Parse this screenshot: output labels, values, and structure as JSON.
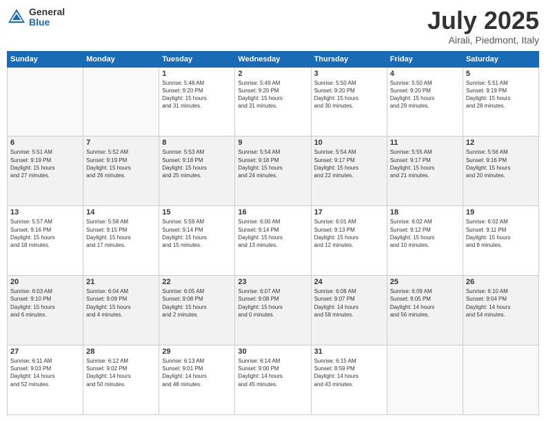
{
  "logo": {
    "general": "General",
    "blue": "Blue"
  },
  "header": {
    "month": "July 2025",
    "location": "Airali, Piedmont, Italy"
  },
  "weekdays": [
    "Sunday",
    "Monday",
    "Tuesday",
    "Wednesday",
    "Thursday",
    "Friday",
    "Saturday"
  ],
  "weeks": [
    [
      {
        "day": "",
        "info": ""
      },
      {
        "day": "",
        "info": ""
      },
      {
        "day": "1",
        "info": "Sunrise: 5:48 AM\nSunset: 9:20 PM\nDaylight: 15 hours\nand 31 minutes."
      },
      {
        "day": "2",
        "info": "Sunrise: 5:49 AM\nSunset: 9:20 PM\nDaylight: 15 hours\nand 31 minutes."
      },
      {
        "day": "3",
        "info": "Sunrise: 5:50 AM\nSunset: 9:20 PM\nDaylight: 15 hours\nand 30 minutes."
      },
      {
        "day": "4",
        "info": "Sunrise: 5:50 AM\nSunset: 9:20 PM\nDaylight: 15 hours\nand 29 minutes."
      },
      {
        "day": "5",
        "info": "Sunrise: 5:51 AM\nSunset: 9:19 PM\nDaylight: 15 hours\nand 28 minutes."
      }
    ],
    [
      {
        "day": "6",
        "info": "Sunrise: 5:51 AM\nSunset: 9:19 PM\nDaylight: 15 hours\nand 27 minutes."
      },
      {
        "day": "7",
        "info": "Sunrise: 5:52 AM\nSunset: 9:19 PM\nDaylight: 15 hours\nand 26 minutes."
      },
      {
        "day": "8",
        "info": "Sunrise: 5:53 AM\nSunset: 9:18 PM\nDaylight: 15 hours\nand 25 minutes."
      },
      {
        "day": "9",
        "info": "Sunrise: 5:54 AM\nSunset: 9:18 PM\nDaylight: 15 hours\nand 24 minutes."
      },
      {
        "day": "10",
        "info": "Sunrise: 5:54 AM\nSunset: 9:17 PM\nDaylight: 15 hours\nand 22 minutes."
      },
      {
        "day": "11",
        "info": "Sunrise: 5:55 AM\nSunset: 9:17 PM\nDaylight: 15 hours\nand 21 minutes."
      },
      {
        "day": "12",
        "info": "Sunrise: 5:56 AM\nSunset: 9:16 PM\nDaylight: 15 hours\nand 20 minutes."
      }
    ],
    [
      {
        "day": "13",
        "info": "Sunrise: 5:57 AM\nSunset: 9:16 PM\nDaylight: 15 hours\nand 18 minutes."
      },
      {
        "day": "14",
        "info": "Sunrise: 5:58 AM\nSunset: 9:15 PM\nDaylight: 15 hours\nand 17 minutes."
      },
      {
        "day": "15",
        "info": "Sunrise: 5:59 AM\nSunset: 9:14 PM\nDaylight: 15 hours\nand 15 minutes."
      },
      {
        "day": "16",
        "info": "Sunrise: 6:00 AM\nSunset: 9:14 PM\nDaylight: 15 hours\nand 13 minutes."
      },
      {
        "day": "17",
        "info": "Sunrise: 6:01 AM\nSunset: 9:13 PM\nDaylight: 15 hours\nand 12 minutes."
      },
      {
        "day": "18",
        "info": "Sunrise: 6:02 AM\nSunset: 9:12 PM\nDaylight: 15 hours\nand 10 minutes."
      },
      {
        "day": "19",
        "info": "Sunrise: 6:02 AM\nSunset: 9:11 PM\nDaylight: 15 hours\nand 8 minutes."
      }
    ],
    [
      {
        "day": "20",
        "info": "Sunrise: 6:03 AM\nSunset: 9:10 PM\nDaylight: 15 hours\nand 6 minutes."
      },
      {
        "day": "21",
        "info": "Sunrise: 6:04 AM\nSunset: 9:09 PM\nDaylight: 15 hours\nand 4 minutes."
      },
      {
        "day": "22",
        "info": "Sunrise: 6:05 AM\nSunset: 9:08 PM\nDaylight: 15 hours\nand 2 minutes."
      },
      {
        "day": "23",
        "info": "Sunrise: 6:07 AM\nSunset: 9:08 PM\nDaylight: 15 hours\nand 0 minutes."
      },
      {
        "day": "24",
        "info": "Sunrise: 6:08 AM\nSunset: 9:07 PM\nDaylight: 14 hours\nand 58 minutes."
      },
      {
        "day": "25",
        "info": "Sunrise: 6:09 AM\nSunset: 9:05 PM\nDaylight: 14 hours\nand 56 minutes."
      },
      {
        "day": "26",
        "info": "Sunrise: 6:10 AM\nSunset: 9:04 PM\nDaylight: 14 hours\nand 54 minutes."
      }
    ],
    [
      {
        "day": "27",
        "info": "Sunrise: 6:11 AM\nSunset: 9:03 PM\nDaylight: 14 hours\nand 52 minutes."
      },
      {
        "day": "28",
        "info": "Sunrise: 6:12 AM\nSunset: 9:02 PM\nDaylight: 14 hours\nand 50 minutes."
      },
      {
        "day": "29",
        "info": "Sunrise: 6:13 AM\nSunset: 9:01 PM\nDaylight: 14 hours\nand 48 minutes."
      },
      {
        "day": "30",
        "info": "Sunrise: 6:14 AM\nSunset: 9:00 PM\nDaylight: 14 hours\nand 45 minutes."
      },
      {
        "day": "31",
        "info": "Sunrise: 6:15 AM\nSunset: 8:59 PM\nDaylight: 14 hours\nand 43 minutes."
      },
      {
        "day": "",
        "info": ""
      },
      {
        "day": "",
        "info": ""
      }
    ]
  ]
}
